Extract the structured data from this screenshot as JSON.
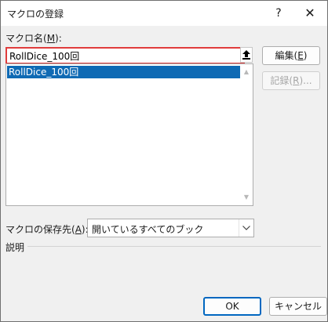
{
  "dialog": {
    "title": "マクロの登録",
    "help_glyph": "?",
    "close_glyph": "✕"
  },
  "macro_name": {
    "label_prefix": "マクロ名(",
    "label_access": "M",
    "label_suffix": "):",
    "value": "RollDice_100回"
  },
  "macro_list": {
    "items": [
      "RollDice_100回"
    ]
  },
  "buttons": {
    "edit_prefix": "編集(",
    "edit_access": "E",
    "edit_suffix": ")",
    "record_prefix": "記録(",
    "record_access": "R",
    "record_suffix": ")...",
    "ok": "OK",
    "cancel": "キャンセル"
  },
  "save_location": {
    "label_prefix": "マクロの保存先(",
    "label_access": "A",
    "label_suffix": "):",
    "selected": "開いているすべてのブック"
  },
  "description": {
    "label": "説明"
  },
  "colors": {
    "highlight_border": "#e03c3c",
    "selection": "#0f6ab4",
    "default_button_border": "#0067c0"
  }
}
